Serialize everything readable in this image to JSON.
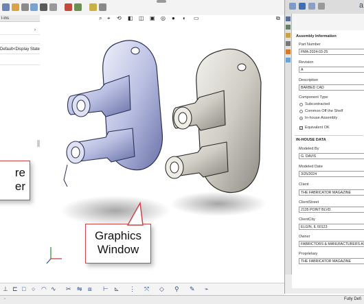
{
  "feature_manager": {
    "tab_label": "l-ins",
    "config_text": "Default<Display State"
  },
  "callouts": {
    "left": {
      "line1": "re",
      "line2": "er"
    },
    "graphics": {
      "line1": "Graphics",
      "line2": "Window"
    }
  },
  "properties": {
    "title": "Assembly Information",
    "part_number_label": "Part Number",
    "part_number": "FMA-2024-03-25",
    "revision_label": "Revision",
    "revision": "A",
    "description_label": "Description",
    "description": "BARBED CAD",
    "component_type_label": "Component Type",
    "component_type_options": [
      "Subcontracted",
      "Common Off the Shelf",
      "In-house Assembly"
    ],
    "component_type_selected": "In-house Assembly",
    "equivalent_label": "Equivalent OK",
    "equivalent_checked": true,
    "inhouse_header": "IN-HOUSE DATA",
    "modeled_by_label": "Modeled By",
    "modeled_by": "G. DAVIS",
    "modeled_date_label": "Modeled Date",
    "modeled_date": "3/25/2024",
    "client_label": "CIient",
    "client": "THE FABRICATOR MAGAZINE",
    "client_street_label": "ClientStreet",
    "client_street": "2135 POINT BLVD.",
    "client_city_label": "ClientCity",
    "client_city": "ELGIN, IL 60123",
    "owner_label": "Owner",
    "owner": "FABRICTORS & MANUFACTURERS ASS",
    "proprietary_label": "Proprietary",
    "proprietary": "THE FABRICATOR MAGAZINE"
  },
  "status": {
    "right_text": "Fully Defi"
  },
  "top_right_partial": "a"
}
